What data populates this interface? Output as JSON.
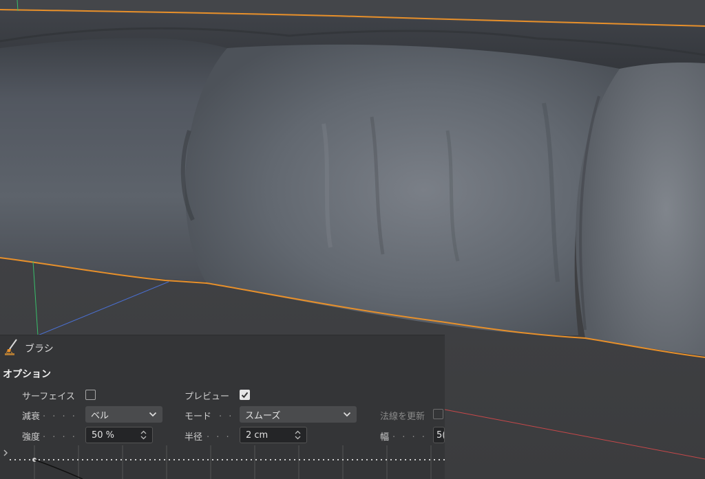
{
  "panel": {
    "title": "ブラシ",
    "section": "オプション",
    "surface_label": "サーフェイス",
    "surface_checked": false,
    "preview_label": "プレビュー",
    "preview_checked": true,
    "falloff_label": "減衰",
    "falloff_value": "ベル",
    "mode_label": "モード",
    "mode_value": "スムーズ",
    "update_normals_label": "法線を更新",
    "update_normals_checked": false,
    "strength_label": "強度",
    "strength_value": "50 %",
    "radius_label": "半径",
    "radius_value": "2 cm",
    "width_label": "幅",
    "width_value": "5("
  },
  "icons": {
    "brush": "brush-icon",
    "expand": "chevron-right-icon",
    "dropdown": "chevron-down-icon",
    "stepper": "stepper-icon",
    "check": "checkmark-icon"
  },
  "colors": {
    "selection_outline": "#e8902a",
    "mesh": "#5a5f66",
    "panel_bg": "#343537"
  }
}
